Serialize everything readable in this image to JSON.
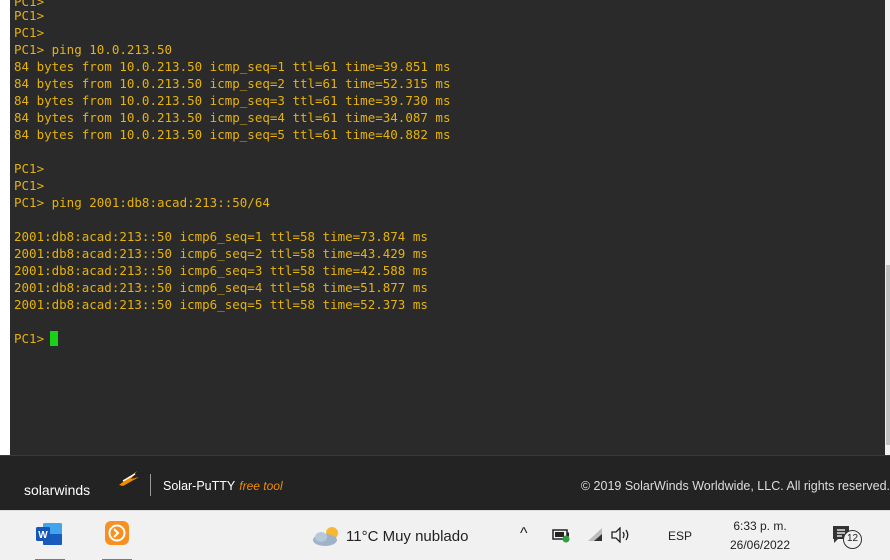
{
  "terminal": {
    "lines": [
      "PC1>",
      "PC1>",
      "PC1>",
      "PC1> ping 10.0.213.50",
      "84 bytes from 10.0.213.50 icmp_seq=1 ttl=61 time=39.851 ms",
      "84 bytes from 10.0.213.50 icmp_seq=2 ttl=61 time=52.315 ms",
      "84 bytes from 10.0.213.50 icmp_seq=3 ttl=61 time=39.730 ms",
      "84 bytes from 10.0.213.50 icmp_seq=4 ttl=61 time=34.087 ms",
      "84 bytes from 10.0.213.50 icmp_seq=5 ttl=61 time=40.882 ms",
      "PC1>",
      "PC1>",
      "PC1> ping 2001:db8:acad:213::50/64",
      "2001:db8:acad:213::50 icmp6_seq=1 ttl=58 time=73.874 ms",
      "2001:db8:acad:213::50 icmp6_seq=2 ttl=58 time=43.429 ms",
      "2001:db8:acad:213::50 icmp6_seq=3 ttl=58 time=42.588 ms",
      "2001:db8:acad:213::50 icmp6_seq=4 ttl=58 time=51.877 ms",
      "2001:db8:acad:213::50 icmp6_seq=5 ttl=58 time=52.373 ms",
      "PC1>"
    ],
    "text_color": "#e6b20c",
    "cursor_color": "#19d119",
    "background": "#2a2a2a"
  },
  "footer": {
    "brand": "solarwinds",
    "product": "Solar-PuTTY",
    "free_tag": "free tool",
    "copyright": "© 2019 SolarWinds Worldwide, LLC. All rights reserved."
  },
  "taskbar": {
    "apps": [
      "word-icon",
      "solar-putty-icon"
    ],
    "weather": "11°C  Muy nublado",
    "language": "ESP",
    "time": "6:33 p. m.",
    "date": "26/06/2022",
    "notification_count": "12"
  }
}
